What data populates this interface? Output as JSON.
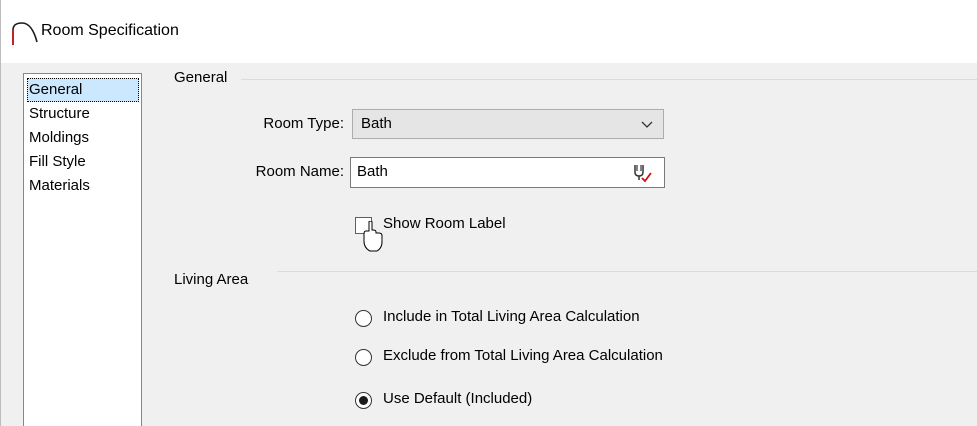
{
  "window": {
    "title": "Room Specification"
  },
  "nav": {
    "items": [
      {
        "label": "General",
        "selected": true
      },
      {
        "label": "Structure",
        "selected": false
      },
      {
        "label": "Moldings",
        "selected": false
      },
      {
        "label": "Fill Style",
        "selected": false
      },
      {
        "label": "Materials",
        "selected": false
      }
    ]
  },
  "general": {
    "group_label": "General",
    "room_type_label": "Room Type:",
    "room_type_value": "Bath",
    "room_name_label": "Room Name:",
    "room_name_value": "Bath",
    "show_label_text": "Show Room Label",
    "show_label_checked": false
  },
  "living_area": {
    "group_label": "Living Area",
    "options": [
      {
        "label": "Include in Total Living Area Calculation",
        "selected": false
      },
      {
        "label": "Exclude from Total Living Area Calculation",
        "selected": false
      },
      {
        "label": "Use Default (Included)",
        "selected": true
      }
    ]
  },
  "colors": {
    "selection_bg": "#cce8ff",
    "focus_border": "#0078d7",
    "dialog_bg": "#f0f0f0"
  },
  "icons": {
    "title": "room-arch-icon",
    "dropdown": "chevron-down-icon",
    "spell": "spell-check-icon",
    "cursor": "mouse-pointer-icon"
  }
}
